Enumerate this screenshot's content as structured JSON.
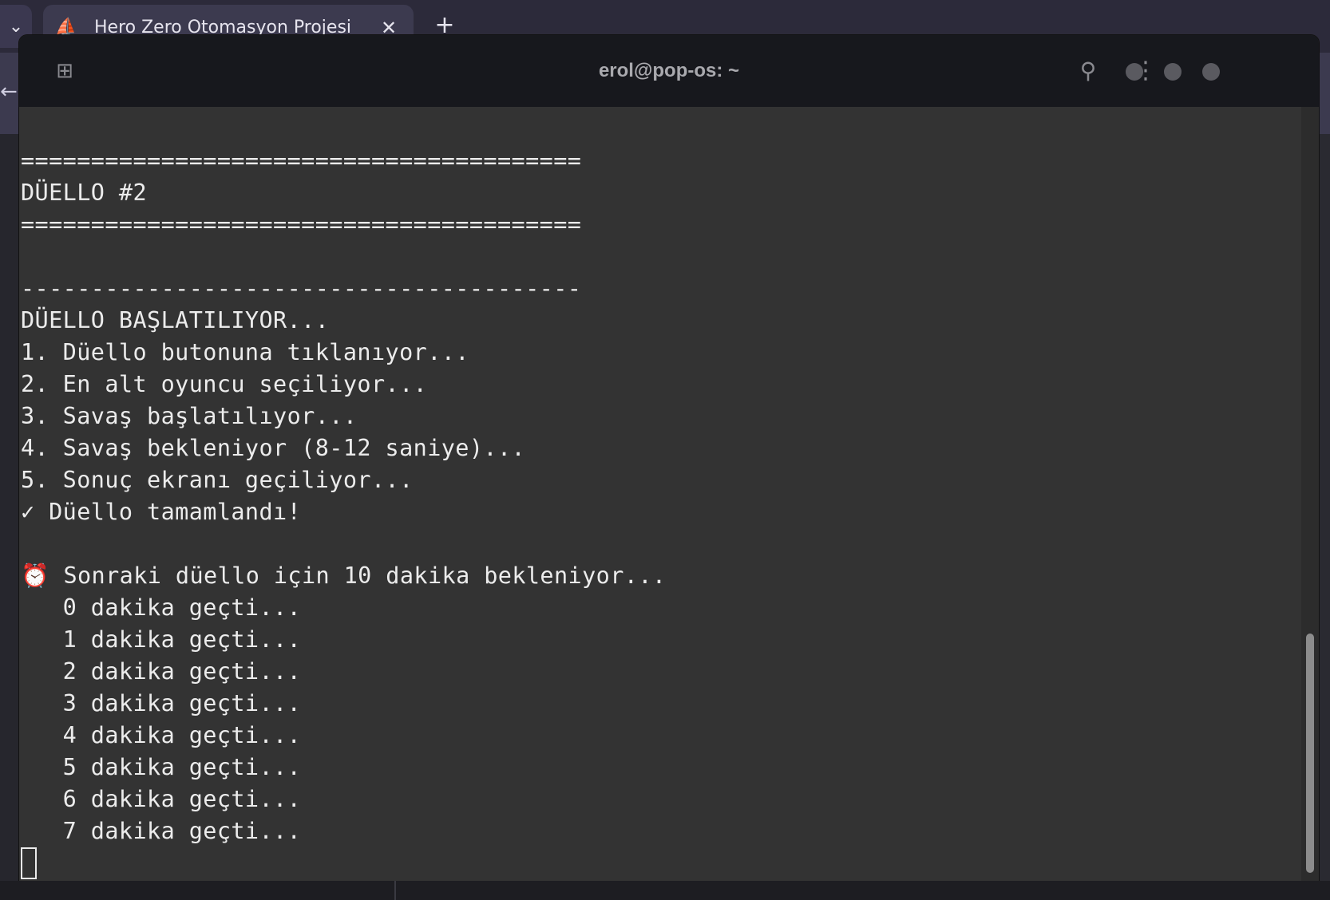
{
  "browser": {
    "tab_list_icon": "chevron-down-icon",
    "tab_title": "Hero Zero Otomasyon Projesi",
    "tab_close_glyph": "✕",
    "new_tab_glyph": "+",
    "back_glyph": "←"
  },
  "terminal": {
    "title": "erol@pop-os: ~",
    "new_tab_glyph": "⊞",
    "search_glyph": "⚲",
    "menu_glyph": "⋮",
    "lines": [
      "========================================",
      "DÜELLO #2",
      "========================================",
      "",
      "----------------------------------------",
      "DÜELLO BAŞLATILIYOR...",
      "1. Düello butonuna tıklanıyor...",
      "2. En alt oyuncu seçiliyor...",
      "3. Savaş başlatılıyor...",
      "4. Savaş bekleniyor (8-12 saniye)...",
      "5. Sonuç ekranı geçiliyor...",
      "✓ Düello tamamlandı!",
      "",
      "⏰ Sonraki düello için 10 dakika bekleniyor...",
      "   0 dakika geçti...",
      "   1 dakika geçti...",
      "   2 dakika geçti...",
      "   3 dakika geçti...",
      "   4 dakika geçti...",
      "   5 dakika geçti...",
      "   6 dakika geçti...",
      "   7 dakika geçti..."
    ]
  },
  "colors": {
    "terminal_bg": "#333333",
    "titlebar_bg": "#17181d",
    "text": "#ececec",
    "tab_accent": "#4f7df3"
  }
}
